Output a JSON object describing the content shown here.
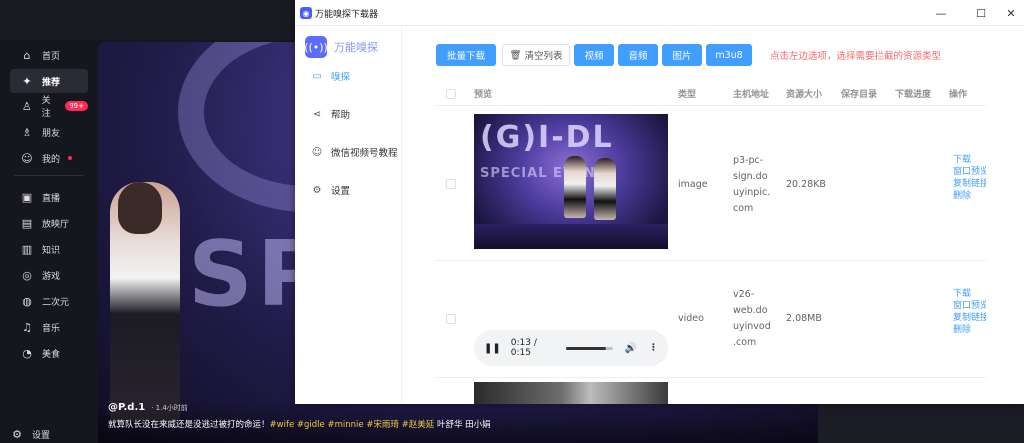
{
  "background_app": {
    "nav": [
      {
        "label": "首页",
        "icon": "home-icon"
      },
      {
        "label": "推荐",
        "icon": "sparkle-icon",
        "active": true
      },
      {
        "label": "关注",
        "icon": "follow-icon",
        "badge": "99+"
      },
      {
        "label": "朋友",
        "icon": "friends-icon"
      },
      {
        "label": "我的",
        "icon": "user-icon",
        "dot": true
      },
      {
        "label": "直播",
        "icon": "live-icon"
      },
      {
        "label": "放映厅",
        "icon": "cinema-icon"
      },
      {
        "label": "知识",
        "icon": "knowledge-icon"
      },
      {
        "label": "游戏",
        "icon": "game-icon"
      },
      {
        "label": "二次元",
        "icon": "anime-icon"
      },
      {
        "label": "音乐",
        "icon": "music-icon"
      },
      {
        "label": "美食",
        "icon": "food-icon"
      }
    ],
    "settings_label": "设置",
    "video": {
      "author": "@P.d.1",
      "time": "· 1.4小时前",
      "caption_text": "就算队长没在来威还是没逃过被打的命运！",
      "tags": [
        "#wife",
        "#gidle",
        "#minnie",
        "#宋雨琦",
        "#赵美延"
      ],
      "caption_tail": "叶舒华 田小娟"
    }
  },
  "window": {
    "title": "万能嗅探下载器",
    "controls": {
      "minimize": "—",
      "maximize": "☐",
      "close": "✕"
    },
    "brand": "万能嗅探",
    "menu": [
      {
        "label": "嗅探",
        "icon": "camera-icon",
        "active": true
      },
      {
        "label": "帮助",
        "icon": "share-icon"
      },
      {
        "label": "微信视频号教程",
        "icon": "wechat-icon"
      },
      {
        "label": "设置",
        "icon": "gear-icon"
      }
    ],
    "toolbar": {
      "batch_download": "批量下载",
      "clear_list": "清空列表",
      "filters": [
        "视频",
        "音频",
        "图片",
        "m3u8"
      ],
      "hint": "点击左边选项，选择需要拦截的资源类型"
    },
    "table": {
      "headers": [
        "预览",
        "类型",
        "主机地址",
        "资源大小",
        "保存目录",
        "下载进度",
        "操作"
      ],
      "rows": [
        {
          "type": "image",
          "host": [
            "p3-pc-",
            "sign.do",
            "uyinpic.",
            "com"
          ],
          "size": "20.28KB",
          "preview_text": "(G)I-DL",
          "preview_sub": "SPECIAL EVEN",
          "actions": [
            "下载",
            "窗口预览",
            "复制链接",
            "删除"
          ]
        },
        {
          "type": "video",
          "host": [
            "v26-",
            "web.do",
            "uyinvod",
            ".com"
          ],
          "size": "2.08MB",
          "player_time": "0:13 / 0:15",
          "progress": 0.867,
          "actions": [
            "下载",
            "窗口预览",
            "复制链接",
            "删除"
          ]
        }
      ]
    }
  }
}
